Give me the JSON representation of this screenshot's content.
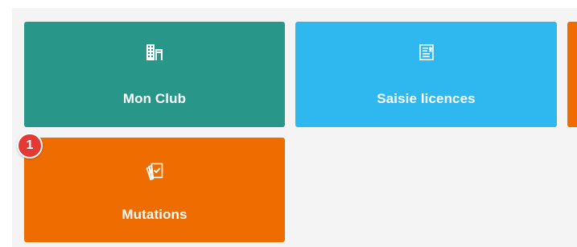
{
  "colors": {
    "page_background": "#ffffff",
    "panel_background": "#f4f4f4",
    "teal": "#28978a",
    "blue": "#2fb7f0",
    "orange": "#ef6c00",
    "badge_red": "#e53935",
    "text_white": "#ffffff"
  },
  "tiles": [
    {
      "label": "Mon Club",
      "icon": "building-icon",
      "color": "#28978a"
    },
    {
      "label": "Saisie licences",
      "icon": "certificate-icon",
      "color": "#2fb7f0"
    },
    {
      "label": "",
      "icon": "",
      "color": "#ef6c00"
    },
    {
      "label": "Mutations",
      "icon": "photo-stack-check-icon",
      "color": "#ef6c00"
    }
  ],
  "notification": {
    "count": "1",
    "color": "#e53935"
  }
}
